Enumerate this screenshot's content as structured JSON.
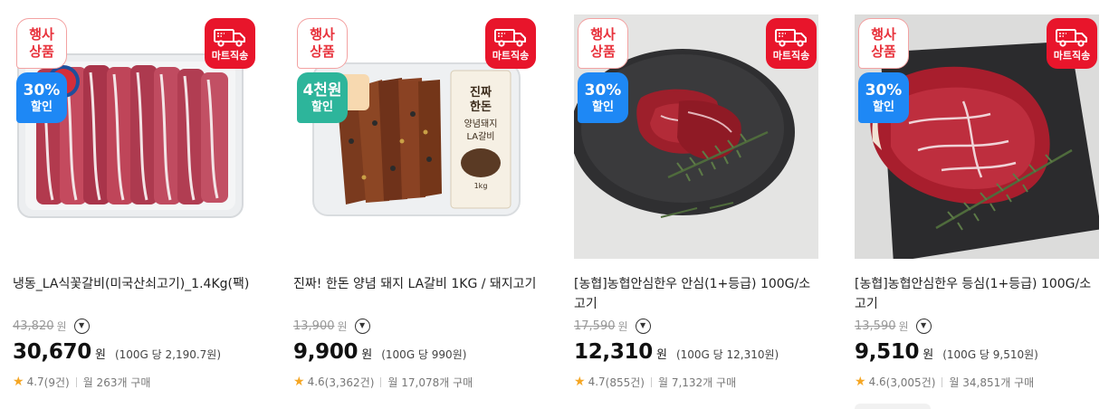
{
  "products": [
    {
      "event_badge": "행사\n상품",
      "discount_big": "30%",
      "discount_small": "할인",
      "delivery_badge": "마트직송",
      "title": "냉동_LA식꽃갈비(미국산쇠고기)_1.4Kg(팩)",
      "original_price": "43,820",
      "original_won": "원",
      "price": "30,670",
      "price_won": "원",
      "unit_price": "(100G 당 2,190.7원)",
      "rating": "4.7",
      "reviews": "(9건)",
      "monthly": "월 263개 구매",
      "discount_color": "#1e88f5",
      "icon": "chevron-down-icon"
    },
    {
      "event_badge": "행사\n상품",
      "discount_big": "4천원",
      "discount_small": "할인",
      "delivery_badge": "마트직송",
      "title": "진짜! 한돈 양념 돼지 LA갈비 1KG / 돼지고기",
      "original_price": "13,900",
      "original_won": "원",
      "price": "9,900",
      "price_won": "원",
      "unit_price": "(100G 당 990원)",
      "rating": "4.6",
      "reviews": "(3,362건)",
      "monthly": "월 17,078개 구매",
      "discount_color": "#2db59b",
      "package_text": "진짜 한돈 양념돼지 LA갈비",
      "package_weight": "1kg",
      "icon": "chevron-down-icon"
    },
    {
      "event_badge": "행사\n상품",
      "discount_big": "30%",
      "discount_small": "할인",
      "delivery_badge": "마트직송",
      "title": "[농협]농협안심한우 안심(1+등급) 100G/소고기",
      "original_price": "17,590",
      "original_won": "원",
      "price": "12,310",
      "price_won": "원",
      "unit_price": "(100G 당 12,310원)",
      "rating": "4.7",
      "reviews": "(855건)",
      "monthly": "월 7,132개 구매",
      "discount_color": "#1e88f5",
      "icon": "chevron-down-icon"
    },
    {
      "event_badge": "행사\n상품",
      "discount_big": "30%",
      "discount_small": "할인",
      "delivery_badge": "마트직송",
      "title": "[농협]농협안심한우 등심(1+등급) 100G/소고기",
      "original_price": "13,590",
      "original_won": "원",
      "price": "9,510",
      "price_won": "원",
      "unit_price": "(100G 당 9,510원)",
      "rating": "4.6",
      "reviews": "(3,005건)",
      "monthly": "월 34,851개 구매",
      "discount_color": "#1e88f5",
      "icon": "chevron-down-icon"
    }
  ],
  "colors": {
    "event_badge_text": "#e8323c",
    "delivery_badge_bg": "#e8152b",
    "star": "#f5a623"
  }
}
